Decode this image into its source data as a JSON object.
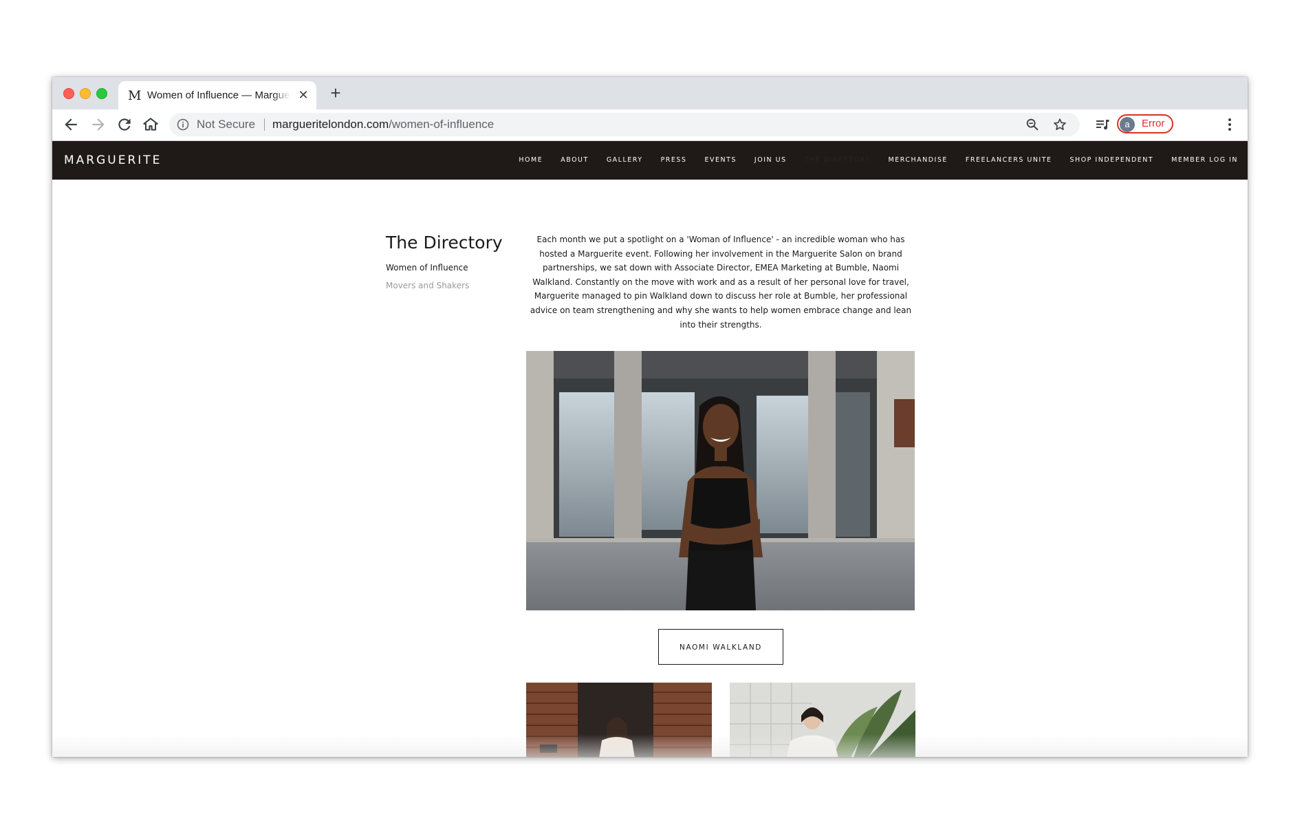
{
  "browser": {
    "tab": {
      "favicon_glyph": "M",
      "title": "Women of Influence — Marguerite",
      "close_glyph": "✕"
    },
    "new_tab_glyph": "+",
    "omnibox": {
      "security_label": "Not Secure",
      "url_host": "margueritelondon.com",
      "url_path": "/women-of-influence"
    },
    "profile": {
      "avatar_letter": "a",
      "status": "Error"
    }
  },
  "site": {
    "logo": "MARGUERITE",
    "nav": [
      {
        "label": "HOME"
      },
      {
        "label": "ABOUT"
      },
      {
        "label": "GALLERY"
      },
      {
        "label": "PRESS"
      },
      {
        "label": "EVENTS"
      },
      {
        "label": "JOIN US"
      },
      {
        "label": "THE DIRECTORY"
      },
      {
        "label": "MERCHANDISE"
      },
      {
        "label": "FREELANCERS UNITE"
      },
      {
        "label": "SHOP INDEPENDENT"
      },
      {
        "label": "MEMBER LOG IN"
      }
    ]
  },
  "sidebar": {
    "title": "The Directory",
    "links": [
      {
        "label": "Women of Influence"
      },
      {
        "label": "Movers and Shakers"
      }
    ]
  },
  "article": {
    "intro": "Each month we put a spotlight on a 'Woman of Influence' - an incredible woman who has hosted a Marguerite event. Following her involvement in the Marguerite Salon on brand partnerships, we sat down with Associate Director, EMEA Marketing at Bumble, Naomi Walkland. Constantly on the move with work and as a result of her personal love for travel, Marguerite managed to pin Walkland down to discuss her role at Bumble, her professional advice on team strengthening and why she wants to help women embrace change and lean into their strengths.",
    "feature_button": "NAOMI WALKLAND"
  },
  "colors": {
    "nav_background": "#1f1a17",
    "error_red": "#d93025",
    "page_background": "#ffffff"
  }
}
